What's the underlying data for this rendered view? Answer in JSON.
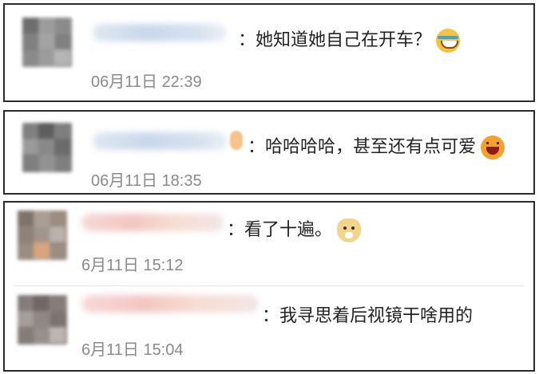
{
  "comments": [
    {
      "separator": "：",
      "text": "她知道她自己在开车？",
      "emoji": "laughing-tears-emoji",
      "time": "06月11日 22:39"
    },
    {
      "separator": "：",
      "text": "哈哈哈哈，甚至还有点可爱",
      "emoji": "grinning-emoji",
      "time": "06月11日 18:35"
    },
    {
      "separator": "：",
      "text": "看了十遍。",
      "emoji": "doge-emoji",
      "time": "6月11日 15:12"
    },
    {
      "separator": "：",
      "text": "我寻思着后视镜干啥用的",
      "emoji": "",
      "time": "6月11日 15:04"
    }
  ]
}
